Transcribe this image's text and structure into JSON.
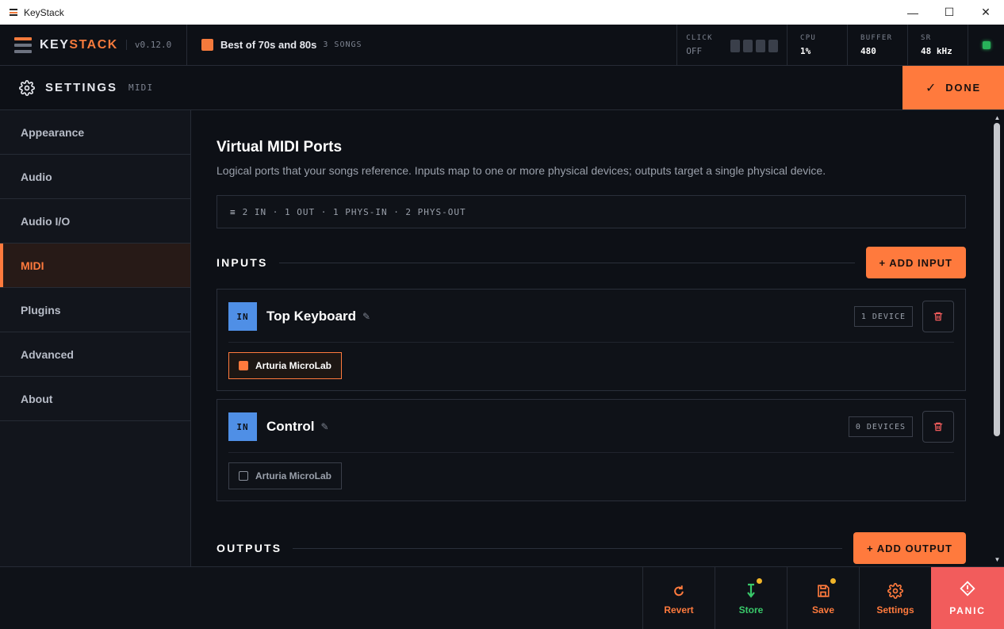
{
  "window": {
    "title": "KeyStack",
    "controls": {
      "minimize": "—",
      "maximize": "☐",
      "close": "✕"
    }
  },
  "header": {
    "brand_key": "KEY",
    "brand_stack": "STACK",
    "version": "v0.12.0",
    "song_title": "Best of 70s and 80s",
    "song_count": "3 SONGS",
    "click_label": "CLICK",
    "click_value": "OFF",
    "cpu_label": "CPU",
    "cpu_value": "1%",
    "buffer_label": "BUFFER",
    "buffer_value": "480",
    "sr_label": "SR",
    "sr_value": "48 kHz"
  },
  "settings_header": {
    "title": "SETTINGS",
    "subtitle": "MIDI",
    "done_label": "DONE"
  },
  "sidebar": {
    "items": [
      {
        "label": "Appearance"
      },
      {
        "label": "Audio"
      },
      {
        "label": "Audio I/O"
      },
      {
        "label": "MIDI"
      },
      {
        "label": "Plugins"
      },
      {
        "label": "Advanced"
      },
      {
        "label": "About"
      }
    ],
    "active": "MIDI"
  },
  "main": {
    "title": "Virtual MIDI Ports",
    "description": "Logical ports that your songs reference. Inputs map to one or more physical devices; outputs target a single physical device.",
    "summary": "2 IN · 1 OUT · 1 PHYS-IN · 2 PHYS-OUT",
    "inputs_section": "INPUTS",
    "add_input_label": "+ ADD INPUT",
    "outputs_section": "OUTPUTS",
    "add_output_label": "+ ADD OUTPUT",
    "inputs": [
      {
        "badge": "IN",
        "name": "Top Keyboard",
        "device_count": "1 DEVICE",
        "device": "Arturia MicroLab",
        "device_selected": true
      },
      {
        "badge": "IN",
        "name": "Control",
        "device_count": "0 DEVICES",
        "device": "Arturia MicroLab",
        "device_selected": false
      }
    ]
  },
  "footer": {
    "revert": "Revert",
    "store": "Store",
    "save": "Save",
    "settings": "Settings",
    "panic": "PANIC"
  },
  "colors": {
    "accent": "#ff7a3d",
    "panic": "#f25c5c",
    "in_badge": "#4f8fe6",
    "store_green": "#39c96a",
    "status_led": "#28b25a",
    "dirty_dot": "#f0b429"
  }
}
